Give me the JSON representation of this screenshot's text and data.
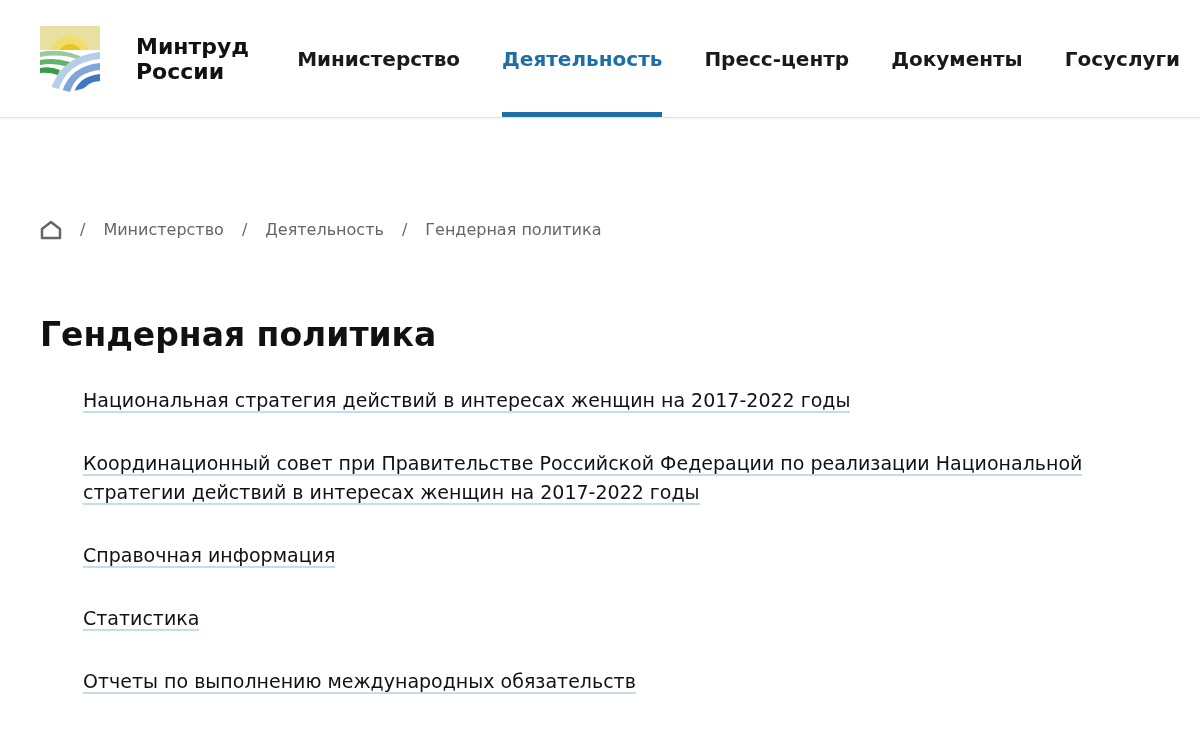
{
  "header": {
    "logo_text": [
      "Минтруд",
      "России"
    ],
    "nav": [
      {
        "label": "Министерство",
        "selected": false
      },
      {
        "label": "Деятельность",
        "selected": true
      },
      {
        "label": "Пресс-центр",
        "selected": false
      },
      {
        "label": "Документы",
        "selected": false
      },
      {
        "label": "Госуслуги",
        "selected": false
      }
    ]
  },
  "breadcrumbs": {
    "separator": "/",
    "items": [
      "Министерство",
      "Деятельность",
      "Гендерная политика"
    ]
  },
  "title": "Гендерная политика",
  "links": [
    "Национальная стратегия действий в интересах женщин на 2017-2022 годы",
    "Координационный совет при Правительстве Российской Федерации по реализации Национальной стратегии действий в интересах женщин на 2017-2022 годы",
    "Справочная информация",
    "Статистика",
    "Отчеты по выполнению международных обязательств"
  ]
}
